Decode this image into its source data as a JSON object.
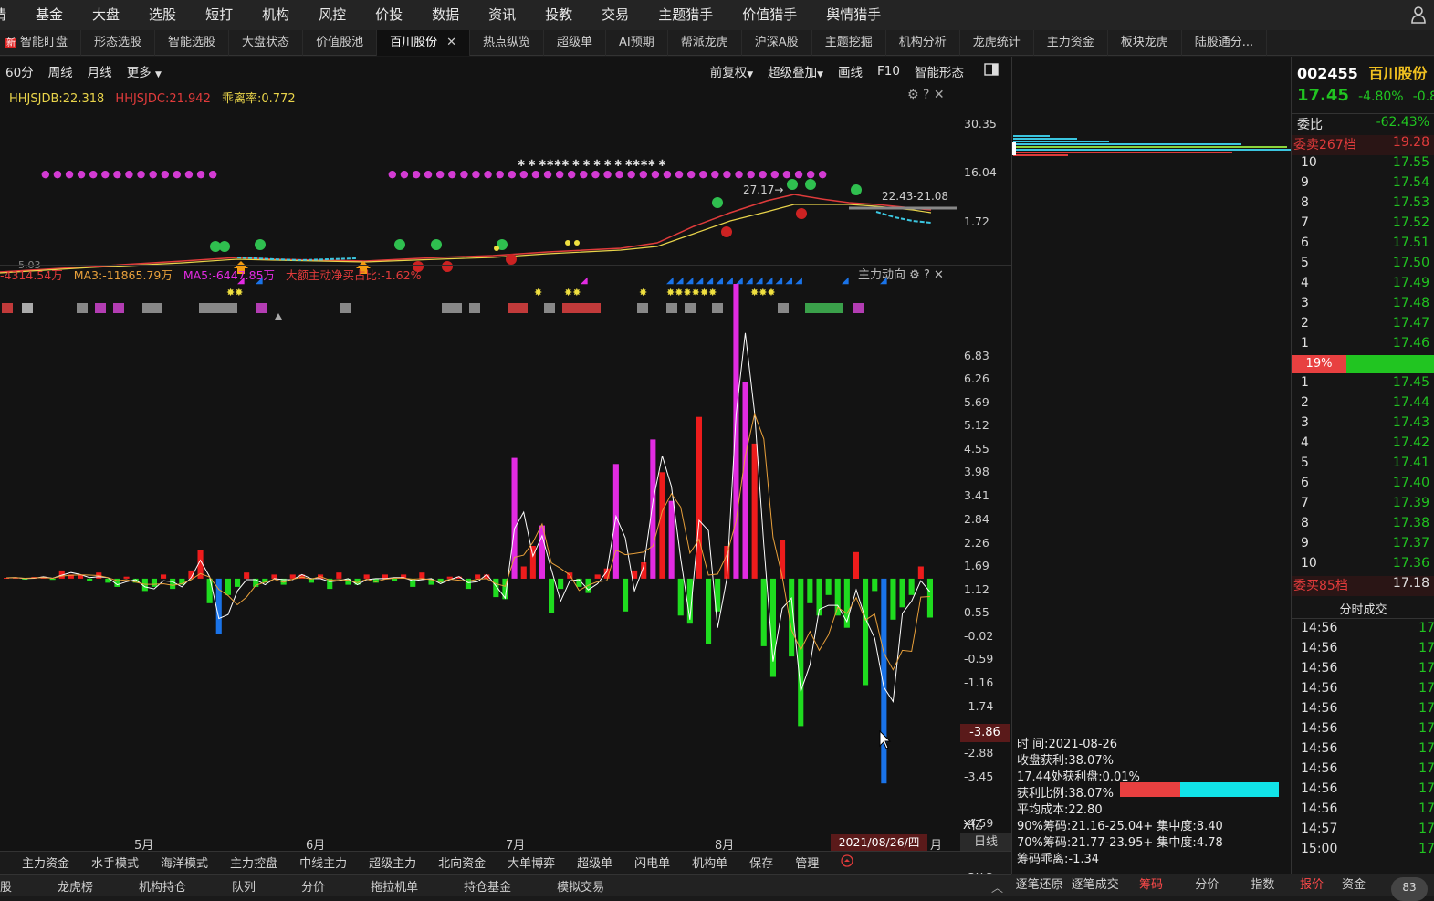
{
  "top_menu": [
    "情",
    "基金",
    "大盘",
    "选股",
    "短打",
    "机构",
    "风控",
    "价投",
    "数据",
    "资讯",
    "投教",
    "交易",
    "主题猎手",
    "价值猎手",
    "舆情猎手"
  ],
  "tabs": [
    "智能盯盘",
    "形态选股",
    "智能选股",
    "大盘状态",
    "价值股池",
    "百川股份",
    "热点纵览",
    "超级单",
    "AI预期",
    "帮派龙虎",
    "沪深A股",
    "主题挖掘",
    "机构分析",
    "龙虎统计",
    "主力资金",
    "板块龙虎",
    "陆股通分..."
  ],
  "new_badge": "新",
  "chart_toolbar": {
    "period_60": "60分",
    "week": "周线",
    "month": "月线",
    "more": "更多",
    "adjust": "前复权",
    "overlay": "超级叠加",
    "draw": "画线",
    "f10": "F10",
    "smart": "智能形态"
  },
  "kline_indicator": {
    "db": "HHJSJDB:22.318",
    "dc": "HHJSJDC:21.942",
    "ratio": "乖离率:0.772",
    "y_labels": [
      "30.35",
      "16.04",
      "1.72"
    ],
    "price_label_range": "22.43-21.08",
    "price_label_peak": "27.17→",
    "price_label_low": "5.03"
  },
  "flow_indicator": {
    "val": "-4314.54万",
    "ma3": "MA3:-11865.79万",
    "ma5": "MA5:-6447.85万",
    "net_ratio": "大额主动净买占比:-1.62%",
    "name": "主力动向",
    "cursor_value": "-3.86",
    "unit": "X亿",
    "y_labels": [
      "6.83",
      "6.26",
      "5.69",
      "5.12",
      "4.55",
      "3.98",
      "3.41",
      "2.84",
      "2.26",
      "1.69",
      "1.12",
      "0.55",
      "-0.02",
      "-0.59",
      "-1.16",
      "-1.74",
      "-2.31",
      "-2.88",
      "-3.45",
      "-4.59",
      "-5.16",
      "-5.73"
    ]
  },
  "x_axis": {
    "labels": [
      "5月",
      "6月",
      "7月",
      "8月"
    ],
    "cursor_date": "2021/08/26/四",
    "month_suffix": "月",
    "daily": "日线"
  },
  "chart_data": {
    "type": "bar",
    "title": "主力动向",
    "ylabel": "X亿",
    "ylim": [
      -6.2,
      7.4
    ],
    "values": [
      0.02,
      0.03,
      -0.02,
      0.04,
      0.05,
      -0.03,
      0.2,
      0.1,
      0.1,
      -0.05,
      0.15,
      -0.1,
      -0.2,
      0.05,
      -0.1,
      -0.3,
      -0.2,
      0.1,
      -0.25,
      -0.15,
      0.2,
      0.7,
      -0.6,
      -1.35,
      -0.4,
      -0.2,
      0.15,
      -0.2,
      -0.1,
      0.1,
      -0.15,
      0.1,
      0.1,
      -0.1,
      0.1,
      -0.25,
      0.15,
      -0.15,
      -0.15,
      0.1,
      -0.1,
      0.1,
      -0.05,
      0.1,
      -0.2,
      0.15,
      -0.15,
      -0.1,
      0.05,
      0.05,
      -0.25,
      0.1,
      0.1,
      -0.45,
      -0.5,
      2.95,
      0.3,
      0.8,
      1.3,
      -0.85,
      -0.25,
      0.15,
      -0.2,
      -0.35,
      0.1,
      0.25,
      2.8,
      -0.8,
      0.2,
      0.4,
      3.4,
      2.6,
      1.9,
      -0.9,
      -1.1,
      3.95,
      -1.6,
      -0.8,
      0.8,
      7.2,
      4.8,
      3.3,
      -1.65,
      -2.4,
      0.95,
      -1.9,
      -3.6,
      -0.6,
      -0.9,
      -0.4,
      -0.9,
      -1.2,
      0.65,
      -2.6,
      -0.3,
      -5.0,
      -1.0,
      -0.7,
      -0.4,
      0.3,
      -0.95
    ],
    "colors": {
      "red": "#ee1c1c",
      "green": "#1fdc1f",
      "magenta": "#e22be2",
      "blue": "#1a73e8"
    }
  },
  "order_book": {
    "code": "002455",
    "name": "百川股份",
    "price": "17.45",
    "change": "-4.80%",
    "change2": "-0.8",
    "weibi_label": "委比",
    "weibi": "-62.43%",
    "sell_title": "委卖267档",
    "sell_price": "19.28",
    "asks": [
      [
        "10",
        "17.55"
      ],
      [
        "9",
        "17.54"
      ],
      [
        "8",
        "17.53"
      ],
      [
        "7",
        "17.52"
      ],
      [
        "6",
        "17.51"
      ],
      [
        "5",
        "17.50"
      ],
      [
        "4",
        "17.49"
      ],
      [
        "3",
        "17.48"
      ],
      [
        "2",
        "17.47"
      ],
      [
        "1",
        "17.46"
      ]
    ],
    "mid_pct": "19%",
    "bids": [
      [
        "1",
        "17.45"
      ],
      [
        "2",
        "17.44"
      ],
      [
        "3",
        "17.43"
      ],
      [
        "4",
        "17.42"
      ],
      [
        "5",
        "17.41"
      ],
      [
        "6",
        "17.40"
      ],
      [
        "7",
        "17.39"
      ],
      [
        "8",
        "17.38"
      ],
      [
        "9",
        "17.37"
      ],
      [
        "10",
        "17.36"
      ]
    ],
    "buy_title": "委买85档",
    "buy_price": "17.18",
    "trades_title": "分时成交",
    "trades": [
      [
        "14:56",
        "17"
      ],
      [
        "14:56",
        "17"
      ],
      [
        "14:56",
        "17"
      ],
      [
        "14:56",
        "17"
      ],
      [
        "14:56",
        "17"
      ],
      [
        "14:56",
        "17"
      ],
      [
        "14:56",
        "17"
      ],
      [
        "14:56",
        "17"
      ],
      [
        "14:56",
        "17"
      ],
      [
        "14:56",
        "17"
      ],
      [
        "14:57",
        "17"
      ],
      [
        "15:00",
        "17"
      ]
    ]
  },
  "chip_info": {
    "date": "时    间:2021-08-26",
    "close_profit": "收盘获利:38.07%",
    "profit_at": "17.44处获利盘:0.01%",
    "profit_ratio": "获利比例:38.07%",
    "avg_cost": "平均成本:22.80",
    "chip90": "90%筹码:21.16-25.04+ 集中度:8.40",
    "chip70": "70%筹码:21.77-23.95+ 集中度:4.78",
    "chip_dev": "筹码乖离:-1.34"
  },
  "bottom_indicators": [
    "主力资金",
    "水手模式",
    "海洋模式",
    "主力控盘",
    "中线主力",
    "超级主力",
    "北向资金",
    "大单博弈",
    "超级单",
    "闪电单",
    "机构单",
    "保存",
    "管理"
  ],
  "footer": [
    "股",
    "龙虎榜",
    "机构持仓",
    "队列",
    "分价",
    "拖拉机单",
    "持仓基金",
    "模拟交易"
  ],
  "mid_footer": [
    "逐笔还原",
    "逐笔成交",
    "筹码",
    "分价",
    "指数"
  ],
  "right_footer": [
    "报价",
    "资金"
  ],
  "avatar_badge": "83"
}
